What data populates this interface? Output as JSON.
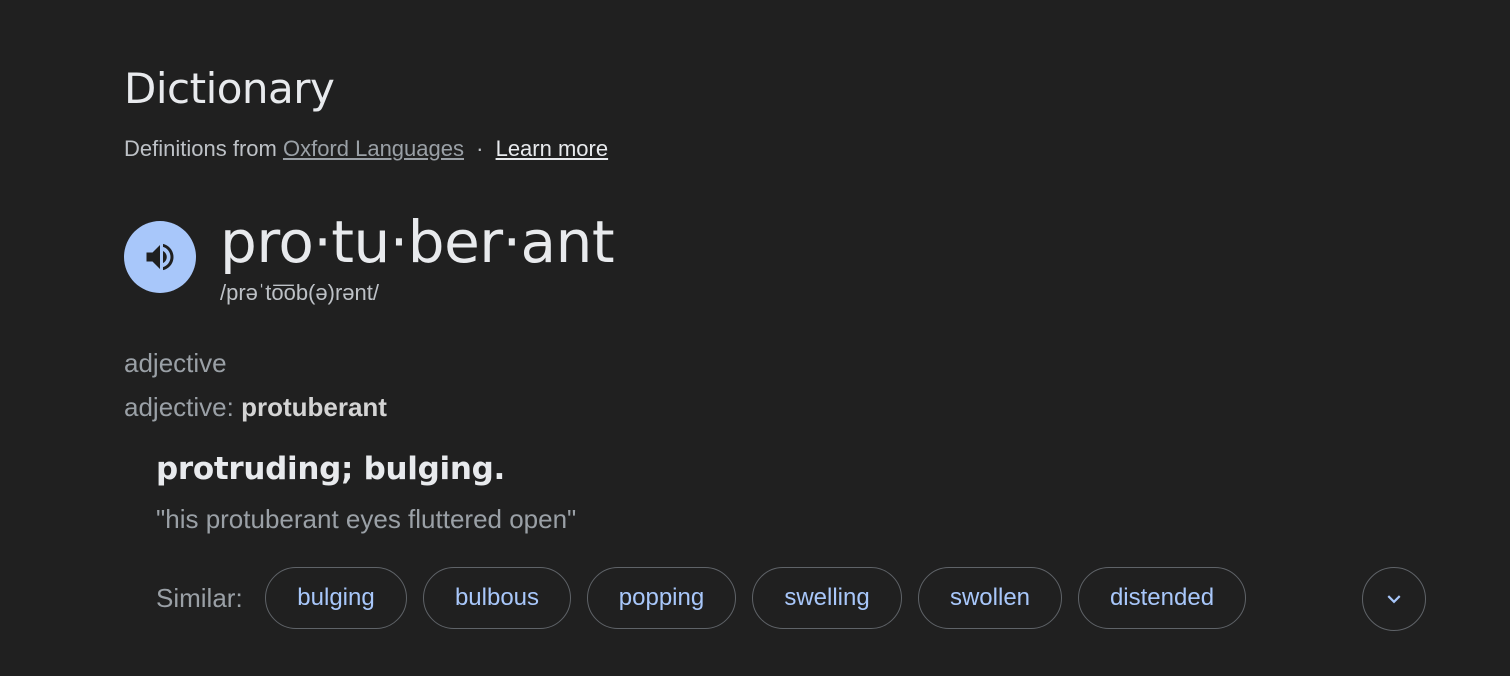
{
  "header": {
    "title": "Dictionary",
    "source_prefix": "Definitions from",
    "source_link": "Oxford Languages",
    "separator": "·",
    "learn_more": "Learn more"
  },
  "entry": {
    "word": "pro·tu·ber·ant",
    "phonetic": "/prəˈto͞ob(ə)rənt/",
    "audio_icon": "speaker-icon",
    "part_of_speech": "adjective",
    "pos_prefix": "adjective:",
    "pos_word": "protuberant",
    "definition": "protruding; bulging.",
    "example": "\"his protuberant eyes fluttered open\""
  },
  "similar": {
    "label": "Similar:",
    "words": [
      "bulging",
      "bulbous",
      "popping",
      "swelling",
      "swollen",
      "distended"
    ],
    "expand_icon": "chevron-down-icon"
  },
  "colors": {
    "background": "#202020",
    "accent": "#a8c7fa",
    "text_primary": "#e8eaed",
    "text_secondary": "#9aa0a6"
  }
}
